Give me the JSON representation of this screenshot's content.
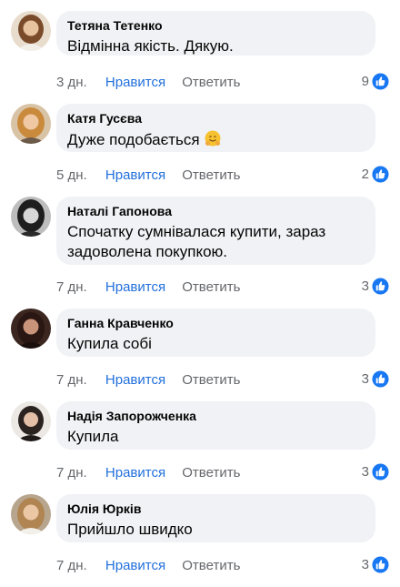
{
  "comments": [
    {
      "author": "Тетяна Тетенко",
      "text": "Відмінна якість. Дякую.",
      "time": "3 дн.",
      "like": "Нравится",
      "reply": "Ответить",
      "reactions": "9",
      "avatar_color": "#c9a27e",
      "hair": "#7a4b2a"
    },
    {
      "author": "Катя Гусєва",
      "text": "Дуже подобається",
      "emoji": "hugging-face",
      "time": "5 дн.",
      "like": "Нравится",
      "reply": "Ответить",
      "reactions": "2",
      "avatar_color": "#e0b58a",
      "hair": "#c98a3c"
    },
    {
      "author": "Наталі Гапонова",
      "text": "Спочатку сумнівалася купити, зараз задоволена покупкою.",
      "time": "7 дн.",
      "like": "Нравится",
      "reply": "Ответить",
      "reactions": "3",
      "avatar_color": "#9a9a9a",
      "hair": "#1e1e1e"
    },
    {
      "author": "Ганна Кравченко",
      "text": "Купила собі",
      "time": "7 дн.",
      "like": "Нравится",
      "reply": "Ответить",
      "reactions": "3",
      "avatar_color": "#7a4f3e",
      "hair": "#2a1612"
    },
    {
      "author": "Надія Запорожченка",
      "text": "Купила",
      "time": "7 дн.",
      "like": "Нравится",
      "reply": "Ответить",
      "reactions": "3",
      "avatar_color": "#ddd6d0",
      "hair": "#2b2320"
    },
    {
      "author": "Юлія Юрків",
      "text": "Прийшло швидко",
      "time": "7 дн.",
      "like": "Нравится",
      "reply": "Ответить",
      "reactions": "3",
      "avatar_color": "#bfa98f",
      "hair": "#b08552"
    }
  ],
  "colors": {
    "link": "#216fdb",
    "muted": "#65676b",
    "bubble": "#f0f2f5",
    "like_badge": "#1877f2"
  }
}
